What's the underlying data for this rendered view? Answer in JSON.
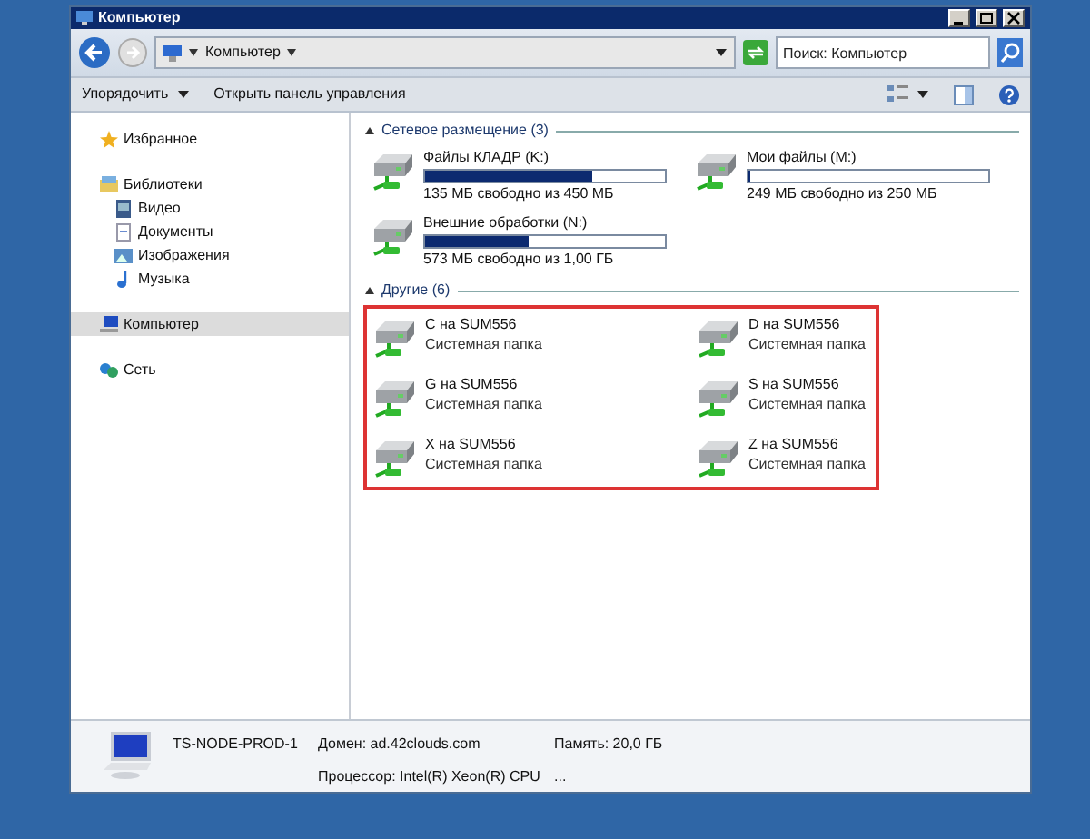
{
  "window": {
    "title": "Компьютер"
  },
  "address": {
    "path": "Компьютер"
  },
  "search": {
    "placeholder": "Поиск: Компьютер"
  },
  "toolbar": [
    {
      "label": "Упорядочить",
      "kind": "menu"
    },
    {
      "label": "Открыть панель управления",
      "kind": "plain"
    }
  ],
  "sidebar": {
    "items": [
      {
        "label": "Избранное",
        "selected": false
      },
      {
        "label": "Библиотеки",
        "selected": false,
        "children": [
          {
            "label": "Видео",
            "selected": false
          },
          {
            "label": "Документы",
            "selected": false
          },
          {
            "label": "Изображения",
            "selected": false
          },
          {
            "label": "Музыка",
            "selected": false
          }
        ]
      },
      {
        "label": "Компьютер",
        "selected": true
      },
      {
        "label": "Сеть",
        "selected": false
      }
    ]
  },
  "groups": [
    {
      "title": "Сетевое размещение (3)",
      "highlighted": false,
      "items": [
        {
          "name": "Файлы КЛАДР (K:)",
          "level": 0.7,
          "reading": "135 МБ свободно из 450 МБ"
        },
        {
          "name": "Мои файлы (M:)",
          "level": 0.004,
          "reading": "249 МБ свободно из 250 МБ"
        },
        {
          "name": "Внешние обработки (N:)",
          "level": 0.43,
          "reading": "573 МБ свободно из 1,00 ГБ"
        }
      ]
    },
    {
      "title": "Другие (6)",
      "highlighted": true,
      "items": [
        {
          "name": "C на SUM556",
          "subtitle": "Системная папка"
        },
        {
          "name": "D на SUM556",
          "subtitle": "Системная папка"
        },
        {
          "name": "G на SUM556",
          "subtitle": "Системная папка"
        },
        {
          "name": "S на SUM556",
          "subtitle": "Системная папка"
        },
        {
          "name": "X на SUM556",
          "subtitle": "Системная папка"
        },
        {
          "name": "Z на SUM556",
          "subtitle": "Системная папка"
        }
      ]
    }
  ],
  "details": {
    "computer_name": "TS-NODE-PROD-1",
    "fields": [
      "Домен: ad.42clouds.com",
      "Память: 20,0 ГБ",
      "Процессор: Intel(R) Xeon(R) CPU",
      "..."
    ]
  }
}
